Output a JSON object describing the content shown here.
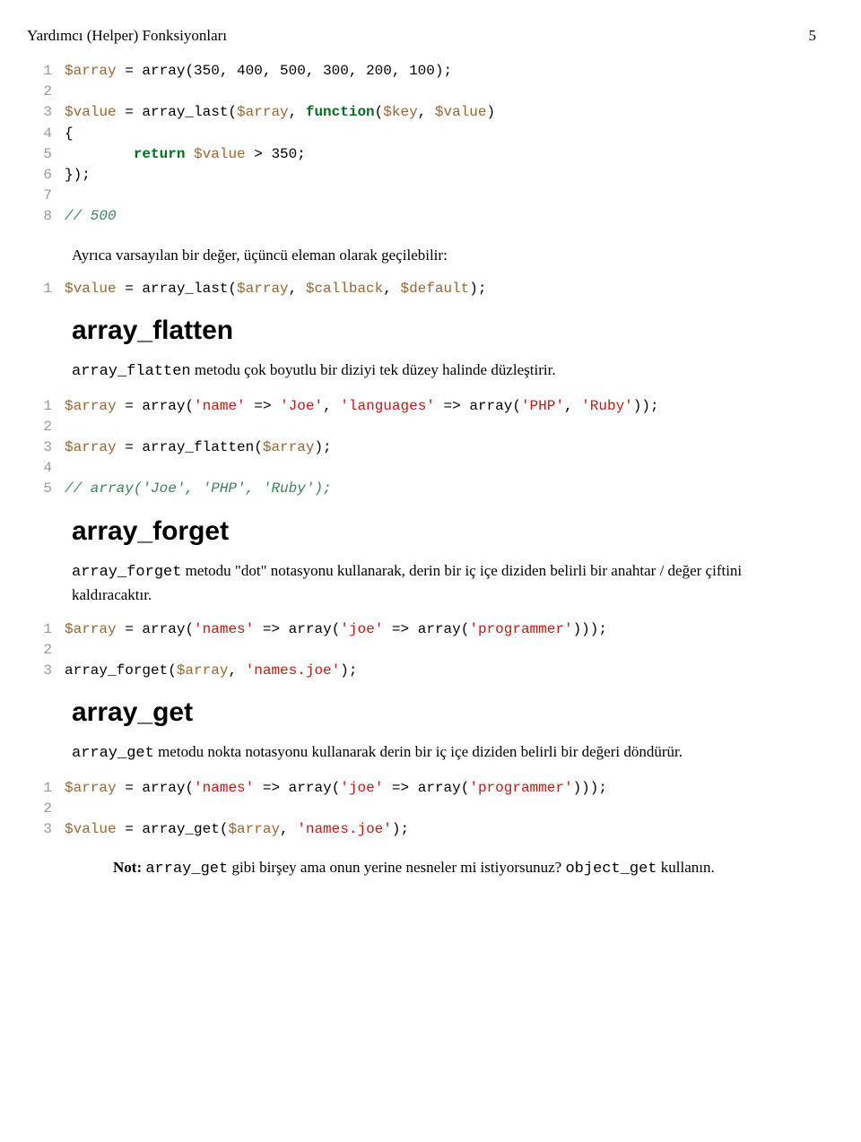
{
  "header": {
    "title": "Yardımcı (Helper) Fonksiyonları",
    "pageNumber": "5"
  },
  "block1": {
    "lines": [
      {
        "n": "1",
        "segs": [
          {
            "t": "$array",
            "c": "k-var"
          },
          {
            "t": " = "
          },
          {
            "t": "array",
            "c": "k-func"
          },
          {
            "t": "(350, 400, 500, 300, 200, 100);"
          }
        ]
      },
      {
        "n": "2",
        "segs": []
      },
      {
        "n": "3",
        "segs": [
          {
            "t": "$value",
            "c": "k-var"
          },
          {
            "t": " = array_last("
          },
          {
            "t": "$array",
            "c": "k-var"
          },
          {
            "t": ", "
          },
          {
            "t": "function",
            "c": "k-kw"
          },
          {
            "t": "("
          },
          {
            "t": "$key",
            "c": "k-var"
          },
          {
            "t": ", "
          },
          {
            "t": "$value",
            "c": "k-var"
          },
          {
            "t": ")"
          }
        ]
      },
      {
        "n": "4",
        "segs": [
          {
            "t": "{"
          }
        ]
      },
      {
        "n": "5",
        "segs": [
          {
            "t": "        "
          },
          {
            "t": "return",
            "c": "k-kw"
          },
          {
            "t": " "
          },
          {
            "t": "$value",
            "c": "k-var"
          },
          {
            "t": " > 350;"
          }
        ]
      },
      {
        "n": "6",
        "segs": [
          {
            "t": "});"
          }
        ]
      },
      {
        "n": "7",
        "segs": []
      },
      {
        "n": "8",
        "segs": [
          {
            "t": "// 500",
            "c": "k-cmt"
          }
        ]
      }
    ]
  },
  "para1": "Ayrıca varsayılan bir değer, üçüncü eleman olarak geçilebilir:",
  "block2": {
    "lines": [
      {
        "n": "1",
        "segs": [
          {
            "t": "$value",
            "c": "k-var"
          },
          {
            "t": " = array_last("
          },
          {
            "t": "$array",
            "c": "k-var"
          },
          {
            "t": ", "
          },
          {
            "t": "$callback",
            "c": "k-var"
          },
          {
            "t": ", "
          },
          {
            "t": "$default",
            "c": "k-var"
          },
          {
            "t": ");"
          }
        ]
      }
    ]
  },
  "sect_flatten": "array_flatten",
  "para_flatten_a": "array_flatten",
  "para_flatten_b": " metodu çok boyutlu bir diziyi tek düzey halinde düzleştirir.",
  "block3": {
    "lines": [
      {
        "n": "1",
        "segs": [
          {
            "t": "$array",
            "c": "k-var"
          },
          {
            "t": " = "
          },
          {
            "t": "array",
            "c": "k-func"
          },
          {
            "t": "("
          },
          {
            "t": "'name'",
            "c": "k-str"
          },
          {
            "t": " => "
          },
          {
            "t": "'Joe'",
            "c": "k-str"
          },
          {
            "t": ", "
          },
          {
            "t": "'languages'",
            "c": "k-str"
          },
          {
            "t": " => "
          },
          {
            "t": "array",
            "c": "k-func"
          },
          {
            "t": "("
          },
          {
            "t": "'PHP'",
            "c": "k-str"
          },
          {
            "t": ", "
          },
          {
            "t": "'Ruby'",
            "c": "k-str"
          },
          {
            "t": "));"
          }
        ]
      },
      {
        "n": "2",
        "segs": []
      },
      {
        "n": "3",
        "segs": [
          {
            "t": "$array",
            "c": "k-var"
          },
          {
            "t": " = array_flatten("
          },
          {
            "t": "$array",
            "c": "k-var"
          },
          {
            "t": ");"
          }
        ]
      },
      {
        "n": "4",
        "segs": []
      },
      {
        "n": "5",
        "segs": [
          {
            "t": "// array('Joe', 'PHP', 'Ruby');",
            "c": "k-cmt"
          }
        ]
      }
    ]
  },
  "sect_forget": "array_forget",
  "para_forget_a": "array_forget",
  "para_forget_b": " metodu \"dot\" notasyonu kullanarak, derin bir iç içe diziden belirli bir anahtar / değer çiftini kaldıracaktır.",
  "block4": {
    "lines": [
      {
        "n": "1",
        "segs": [
          {
            "t": "$array",
            "c": "k-var"
          },
          {
            "t": " = "
          },
          {
            "t": "array",
            "c": "k-func"
          },
          {
            "t": "("
          },
          {
            "t": "'names'",
            "c": "k-str"
          },
          {
            "t": " => "
          },
          {
            "t": "array",
            "c": "k-func"
          },
          {
            "t": "("
          },
          {
            "t": "'joe'",
            "c": "k-str"
          },
          {
            "t": " => "
          },
          {
            "t": "array",
            "c": "k-func"
          },
          {
            "t": "("
          },
          {
            "t": "'programmer'",
            "c": "k-str"
          },
          {
            "t": ")));"
          }
        ]
      },
      {
        "n": "2",
        "segs": []
      },
      {
        "n": "3",
        "segs": [
          {
            "t": "array_forget("
          },
          {
            "t": "$array",
            "c": "k-var"
          },
          {
            "t": ", "
          },
          {
            "t": "'names.joe'",
            "c": "k-str"
          },
          {
            "t": ");"
          }
        ]
      }
    ]
  },
  "sect_get": "array_get",
  "para_get_a": "array_get",
  "para_get_b": " metodu nokta notasyonu kullanarak derin bir iç içe diziden belirli bir değeri döndürür.",
  "block5": {
    "lines": [
      {
        "n": "1",
        "segs": [
          {
            "t": "$array",
            "c": "k-var"
          },
          {
            "t": " = "
          },
          {
            "t": "array",
            "c": "k-func"
          },
          {
            "t": "("
          },
          {
            "t": "'names'",
            "c": "k-str"
          },
          {
            "t": " => "
          },
          {
            "t": "array",
            "c": "k-func"
          },
          {
            "t": "("
          },
          {
            "t": "'joe'",
            "c": "k-str"
          },
          {
            "t": " => "
          },
          {
            "t": "array",
            "c": "k-func"
          },
          {
            "t": "("
          },
          {
            "t": "'programmer'",
            "c": "k-str"
          },
          {
            "t": ")));"
          }
        ]
      },
      {
        "n": "2",
        "segs": []
      },
      {
        "n": "3",
        "segs": [
          {
            "t": "$value",
            "c": "k-var"
          },
          {
            "t": " = array_get("
          },
          {
            "t": "$array",
            "c": "k-var"
          },
          {
            "t": ", "
          },
          {
            "t": "'names.joe'",
            "c": "k-str"
          },
          {
            "t": ");"
          }
        ]
      }
    ]
  },
  "note": {
    "bold": "Not:",
    "t1": " ",
    "m1": "array_get",
    "t2": " gibi birşey ama onun yerine nesneler mi istiyorsunuz? ",
    "m2": "object_get",
    "t3": " kullanın."
  }
}
